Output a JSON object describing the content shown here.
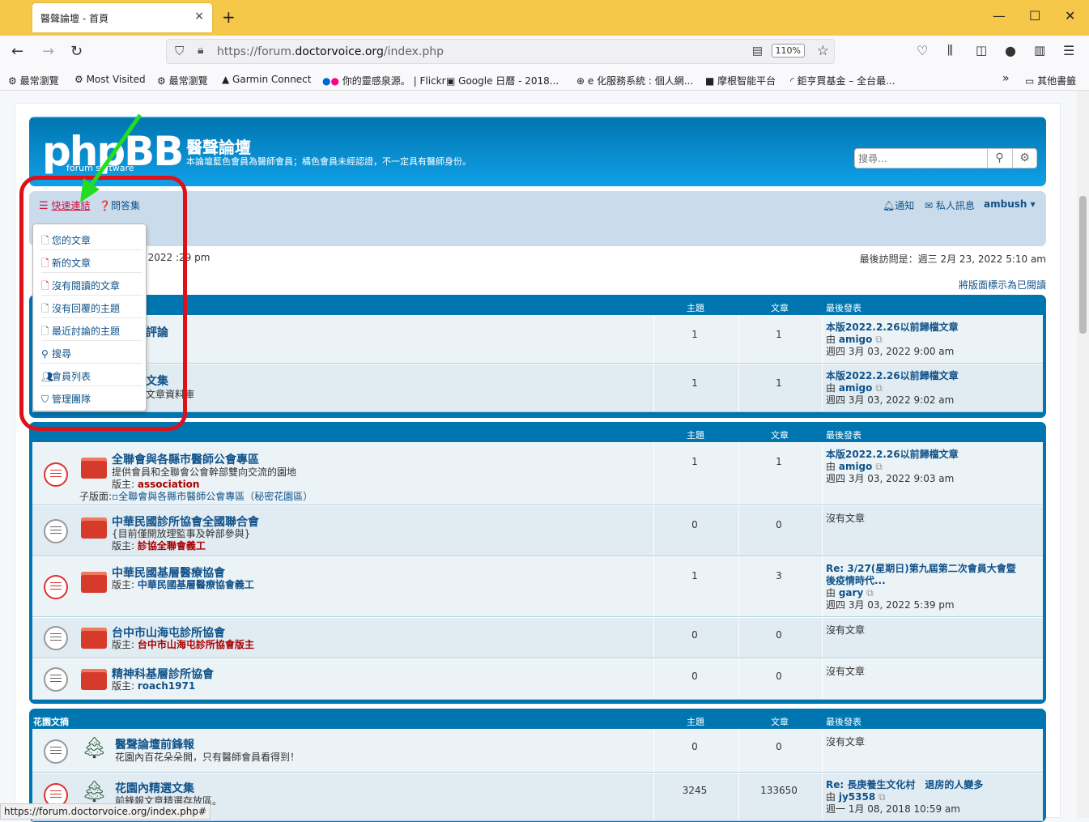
{
  "browser": {
    "tab_title": "醫聲論壇 - 首頁",
    "tab_close": "×",
    "newtab": "+",
    "url_prefix": "https://forum.",
    "url_domain": "doctorvoice.org",
    "url_path": "/index.php",
    "zoom": "110%",
    "status_url": "https://forum.doctorvoice.org/index.php#",
    "bookmarks": [
      "最常瀏覽",
      "Most Visited",
      "最常瀏覽",
      "Garmin Connect",
      "你的靈感泉源。 | Flickr",
      "Google 日曆 - 2018...",
      "e 化服務系統 : 個人網...",
      "摩根智能平台",
      "鉅亨買基金 – 全台最...",
      "其他書籤"
    ],
    "colors": {
      "tabbar": "#f6c84a",
      "urlbar": "#f0f0f4"
    }
  },
  "header": {
    "logo": "phpBB",
    "logo_sub": "forum   software",
    "site_name": "醫聲論壇",
    "site_desc": "本論壇藍色會員為醫師會員；橘色會員未經認證，不一定具有醫師身份。",
    "search_placeholder": "搜尋…"
  },
  "nav": {
    "quick_links": "快速連結",
    "faq": "問答集",
    "notifications": "通知",
    "pm": "私人訊息",
    "username": "ambush"
  },
  "dropdown": [
    {
      "icon": "file-icon",
      "label": "您的文章"
    },
    {
      "icon": "file-red-icon",
      "label": "新的文章"
    },
    {
      "icon": "file-red-icon",
      "label": "沒有閱讀的文章"
    },
    {
      "icon": "file-icon",
      "label": "沒有回覆的主題"
    },
    {
      "icon": "file-icon",
      "label": "最近討論的主題"
    },
    {
      "icon": "search-icon",
      "label": "搜尋"
    },
    {
      "icon": "users-icon",
      "label": "會員列表"
    },
    {
      "icon": "shield-icon",
      "label": "管理團隊"
    }
  ],
  "info": {
    "current_visit": ", 2022 :29 pm",
    "last_visit": "最後訪問是：週三 2月 23, 2022 5:10 am",
    "mark_read": "將版面標示為已閱讀"
  },
  "columns": {
    "topics": "主題",
    "posts": "文章",
    "last_post": "最後發表"
  },
  "cat1": {
    "rows": [
      {
        "title_tail": "評論",
        "desc_tail": "",
        "topics": "1",
        "posts": "1",
        "lp_title": "本版2022.2.26以前歸檔文章",
        "lp_by": "由",
        "lp_user": "amigo",
        "lp_time": "週四 3月 03, 2022 9:00 am"
      },
      {
        "title_tail": "文集",
        "desc_tail": "文章資料庫",
        "topics": "1",
        "posts": "1",
        "lp_title": "本版2022.2.26以前歸檔文章",
        "lp_by": "由",
        "lp_user": "amigo",
        "lp_time": "週四 3月 03, 2022 9:02 am"
      }
    ]
  },
  "cat2": {
    "rows": [
      {
        "title": "全聯會與各縣市醫師公會專區",
        "desc": "提供會員和全聯會公會幹部雙向交流的園地",
        "mod_label": "版主:",
        "mod": "association",
        "sub_label": "子版面:",
        "sub": "全聯會與各縣市醫師公會專區（秘密花園區）",
        "topics": "1",
        "posts": "1",
        "lp_title": "本版2022.2.26以前歸檔文章",
        "lp_by": "由",
        "lp_user": "amigo",
        "lp_time": "週四 3月 03, 2022 9:03 am"
      },
      {
        "title": "中華民國診所協會全國聯合會",
        "desc": "{目前僅開放理監事及幹部參與}",
        "mod_label": "版主:",
        "mod": "診協全聯會義工",
        "topics": "0",
        "posts": "0",
        "no_post": "沒有文章"
      },
      {
        "title": "中華民國基層醫療協會",
        "mod_label": "版主:",
        "mod": "中華民國基層醫療協會義工",
        "topics": "1",
        "posts": "3",
        "lp_title": "Re: 3/27(星期日)第九屆第二次會員大會暨",
        "lp_title2": "後疫情時代...",
        "lp_by": "由",
        "lp_user": "gary",
        "lp_time": "週四 3月 03, 2022 5:39 pm"
      },
      {
        "title": "台中市山海屯診所協會",
        "mod_label": "版主:",
        "mod": "台中市山海屯診所協會版主",
        "topics": "0",
        "posts": "0",
        "no_post": "沒有文章"
      },
      {
        "title": "精神科基層診所協會",
        "mod_label": "版主:",
        "mod": "roach1971",
        "topics": "0",
        "posts": "0",
        "no_post": "沒有文章"
      }
    ]
  },
  "cat3": {
    "name": "花園文摘",
    "rows": [
      {
        "title": "醫聲論壇前鋒報",
        "desc": "花園內百花朵朵開，只有醫師會員看得到！",
        "topics": "0",
        "posts": "0",
        "no_post": "沒有文章"
      },
      {
        "title": "花園內精選文集",
        "desc": "前鋒報文章精選存放區。",
        "topics": "3245",
        "posts": "133650",
        "lp_title": "Re: 長庚養生文化村　退房的人變多",
        "lp_by": "由",
        "lp_user": "jy5358",
        "lp_time": "週一 1月 08, 2018 10:59 am"
      }
    ]
  }
}
